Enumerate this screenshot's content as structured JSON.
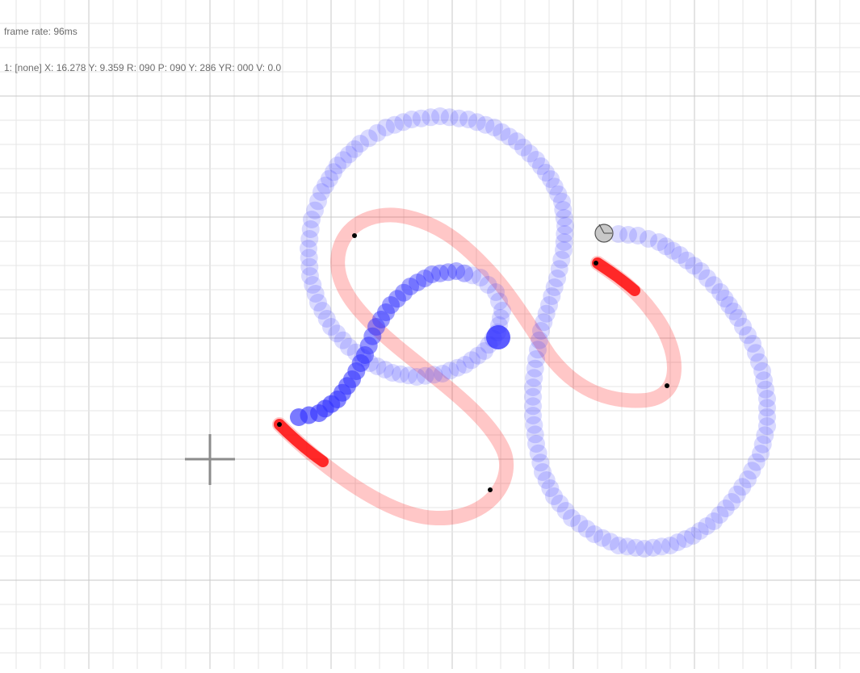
{
  "hud": {
    "frame_rate_label": "frame rate: 96ms",
    "tracker_status": "1: [none] X: 16.278 Y: 9.359 R: 090 P: 090 Y: 286 YR: 000 V: 0.0"
  },
  "colors": {
    "background": "#ffffff",
    "grid_minor": "#e6e6e6",
    "grid_major": "#c8c8c8",
    "red_stroke": "#ff0000",
    "blue_trail": "#3333ff",
    "control_point": "#000000",
    "crosshair": "#8c8c8c",
    "cursor_ball": "#c8c8c8"
  }
}
